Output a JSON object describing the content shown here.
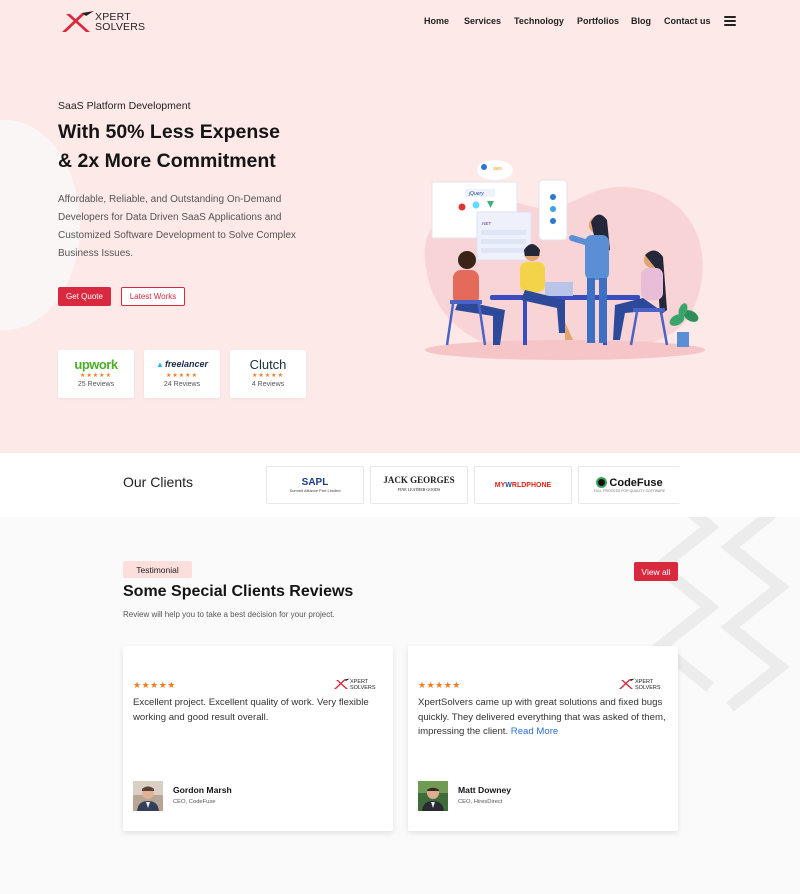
{
  "brand": {
    "line1": "XPERT",
    "line2": "SOLVERS",
    "accent": "#d8293f"
  },
  "nav": {
    "items": [
      "Home",
      "Services",
      "Technology",
      "Portfolios",
      "Blog",
      "Contact us"
    ],
    "menu_icon": "hamburger-icon"
  },
  "hero": {
    "eyebrow": "SaaS Platform Development",
    "headline_1": "With 50% Less Expense",
    "headline_2": "& 2x More Commitment",
    "lede": "Affordable, Reliable, and Outstanding On-Demand Developers for Data Driven SaaS Applications and Customized Software Development to Solve Complex Business Issues.",
    "cta_primary": "Get Quote",
    "cta_secondary": "Latest Works",
    "review_platforms": [
      {
        "name": "Upwork",
        "brand": "upwork",
        "stars": 5,
        "reviews": "25 Reviews"
      },
      {
        "name": "freelancer",
        "brand": "freelancer",
        "stars": 5,
        "reviews": "24 Reviews"
      },
      {
        "name": "Clutch",
        "brand": "Clutch",
        "stars": 5,
        "reviews": "4 Reviews"
      }
    ],
    "illustration_labels": {
      "jquery": "jQuery",
      "aws": "aws",
      "net": ".NET"
    }
  },
  "clients": {
    "title": "Our Clients",
    "logos": [
      {
        "name": "SAPL",
        "tagline": "Summit Alliance Port Limited"
      },
      {
        "name": "JACK GEORGES",
        "tagline": "FINE LEATHER GOODS"
      },
      {
        "name_pre": "MY",
        "name_w": "W",
        "name_post": "RLDPHONE"
      },
      {
        "name": "CodeFuse",
        "tagline": "FULL PROCESS FOR QUALITY SOFTWARE"
      }
    ]
  },
  "testimonials": {
    "tag": "Testimonial",
    "title": "Some Special Clients Reviews",
    "subtitle": "Review will help you to take a best decision for your project.",
    "view_all": "View all",
    "reviews": [
      {
        "stars": "★★★★★",
        "quote": "Excellent project. Excellent quality of work. Very flexible working and good result overall.",
        "read_more": "",
        "name": "Gordon Marsh",
        "role": "CEO, CodeFuse"
      },
      {
        "stars": "★★★★★",
        "quote": "XpertSolvers came up with great solutions and fixed bugs quickly. They delivered everything that was asked of them, impressing the client.",
        "read_more": "Read More",
        "name": "Matt Downey",
        "role": "CEO, HiresDirect"
      }
    ]
  },
  "colors": {
    "hero_bg": "#fde9e8",
    "accent": "#d8293f",
    "star": "#f37a20",
    "link": "#2a6fd6"
  }
}
